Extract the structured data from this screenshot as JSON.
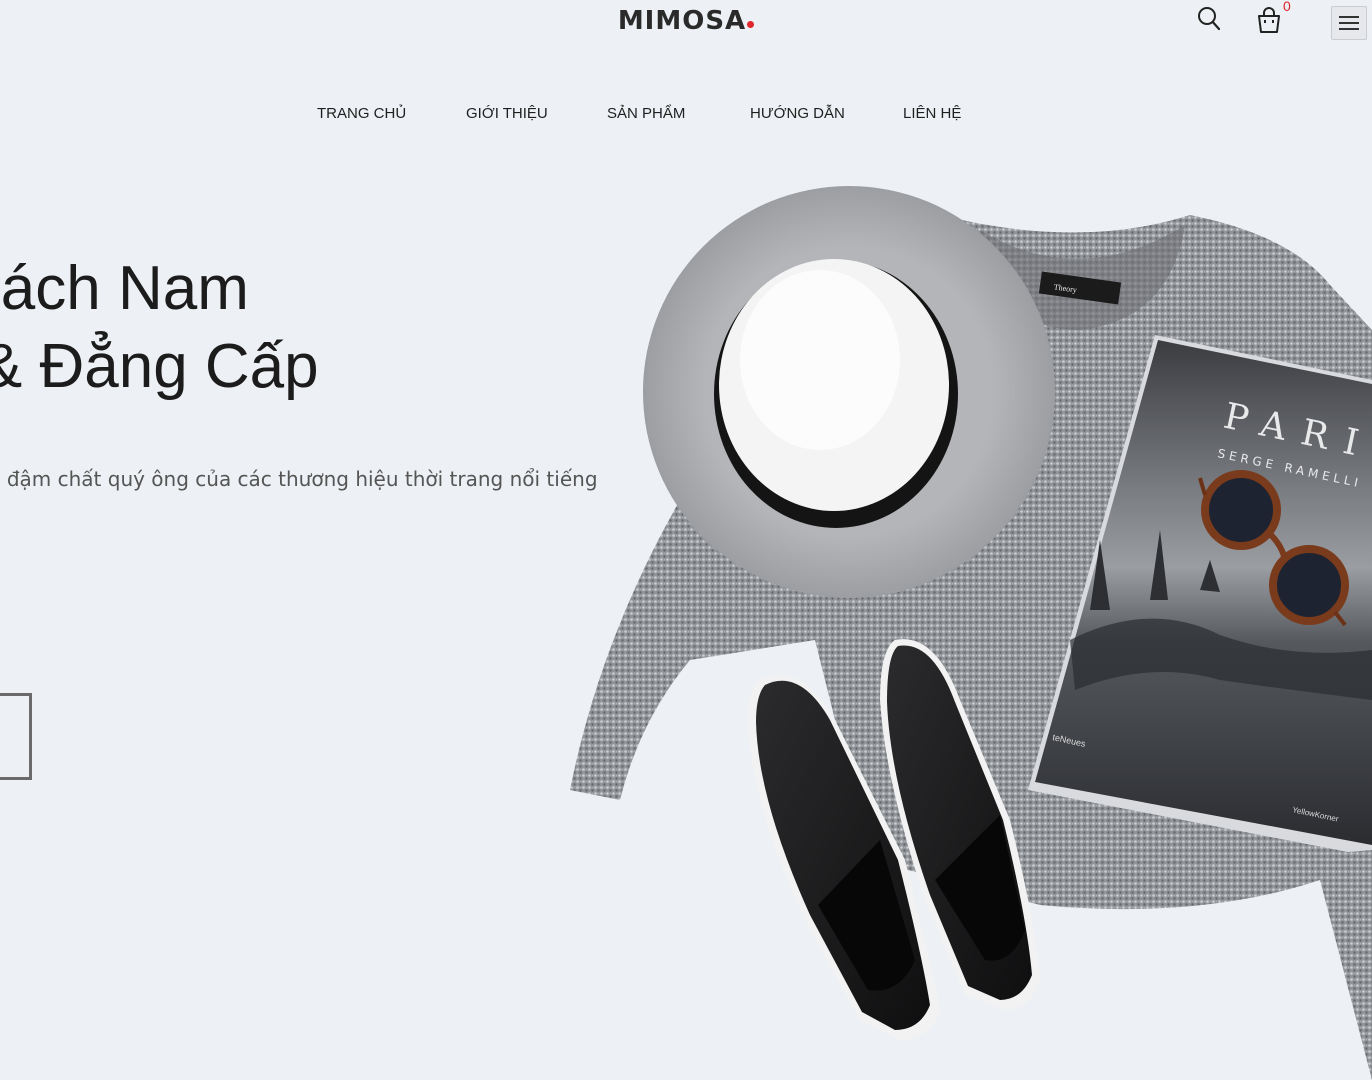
{
  "header": {
    "logo_text": "MIMOSA",
    "cart_count": "0"
  },
  "nav": {
    "items": [
      {
        "label": "TRANG CHỦ"
      },
      {
        "label": "GIỚI THIỆU"
      },
      {
        "label": "SẢN PHẨM"
      },
      {
        "label": "HƯỚNG DẪN"
      },
      {
        "label": "LIÊN HỆ"
      }
    ]
  },
  "hero": {
    "title_line1": "Cách Nam",
    "title_line2": "m & Đẳng Cấp",
    "subtitle_line1": "nới đậm chất quý ông của các thương hiệu thời trang nổi tiếng",
    "subtitle_line2": "."
  },
  "image": {
    "sweater_label": "Theory",
    "book_title": "PARIS",
    "book_author": "SERGE RAMELLI",
    "book_publisher": "teNeues",
    "book_imprint": "YellowKorner"
  },
  "colors": {
    "background": "#edf0f4",
    "accent": "#e0262a",
    "text": "#1c1c1c"
  }
}
